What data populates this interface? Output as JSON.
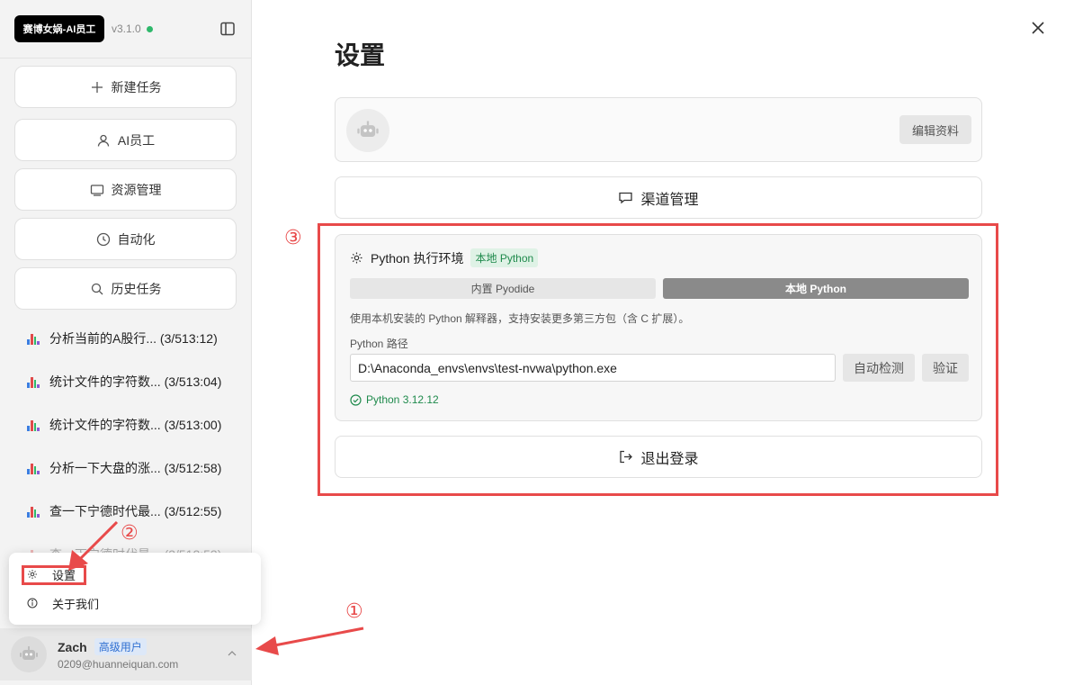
{
  "app": {
    "brand": "赛博女娲-AI员工",
    "version": "v3.1.0",
    "status_color": "#2eb86b"
  },
  "sidebar": {
    "nav": [
      {
        "label": "新建任务",
        "icon": "plus-icon"
      },
      {
        "label": "AI员工",
        "icon": "user-icon"
      },
      {
        "label": "资源管理",
        "icon": "monitor-icon"
      },
      {
        "label": "自动化",
        "icon": "clock-icon"
      },
      {
        "label": "历史任务",
        "icon": "search-icon"
      }
    ],
    "history": [
      {
        "title": "分析当前的A股行...",
        "time": "(3/513:12)"
      },
      {
        "title": "统计文件的字符数...",
        "time": "(3/513:04)"
      },
      {
        "title": "统计文件的字符数...",
        "time": "(3/513:00)"
      },
      {
        "title": "分析一下大盘的涨...",
        "time": "(3/512:58)"
      },
      {
        "title": "查一下宁德时代最...",
        "time": "(3/512:55)"
      },
      {
        "title": "查一下宁德时代最...",
        "time": "(3/512:53)"
      }
    ]
  },
  "popup_menu": {
    "items": [
      {
        "label": "设置",
        "icon": "gear-icon"
      },
      {
        "label": "关于我们",
        "icon": "info-icon"
      }
    ]
  },
  "user": {
    "name": "Zach",
    "badge": "高级用户",
    "email": "0209@huanneiquan.com"
  },
  "settings": {
    "title": "设置",
    "edit_profile": "编辑资料",
    "channel_management": "渠道管理",
    "python": {
      "header": "Python 执行环境",
      "tag": "本地 Python",
      "tab_builtin": "内置 Pyodide",
      "tab_local": "本地 Python",
      "description": "使用本机安装的 Python 解释器，支持安装更多第三方包（含 C 扩展）。",
      "path_label": "Python 路径",
      "path_value": "D:\\Anaconda_envs\\envs\\test-nvwa\\python.exe",
      "auto_detect": "自动检测",
      "verify": "验证",
      "status": "Python 3.12.12"
    },
    "logout": "退出登录"
  },
  "annotations": {
    "one": "①",
    "two": "②",
    "three": "③",
    "color": "#e84a4a"
  }
}
